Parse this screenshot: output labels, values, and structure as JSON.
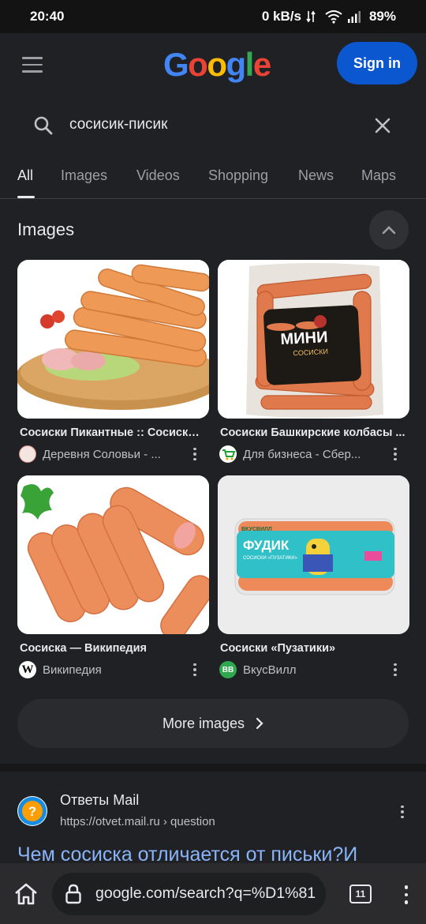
{
  "status_bar": {
    "time": "20:40",
    "network_speed": "0 kB/s",
    "battery": "89%"
  },
  "header": {
    "logo_letters": [
      "G",
      "o",
      "o",
      "g",
      "l",
      "e"
    ],
    "signin_label": "Sign in"
  },
  "search": {
    "query": "сосисик-писик"
  },
  "tabs": [
    {
      "label": "All",
      "active": true
    },
    {
      "label": "Images",
      "active": false
    },
    {
      "label": "Videos",
      "active": false
    },
    {
      "label": "Shopping",
      "active": false
    },
    {
      "label": "News",
      "active": false
    },
    {
      "label": "Maps",
      "active": false
    }
  ],
  "images_section": {
    "title": "Images",
    "results": [
      {
        "title": "Сосиски Пикантные :: Сосиски ...",
        "source": "Деревня Соловьи - ..."
      },
      {
        "title": "Сосиски Башкирские колбасы ...",
        "source": "Для бизнеса - Сбер..."
      },
      {
        "title": "Сосиска — Википедия",
        "source": "Википедия"
      },
      {
        "title": "Сосиски «Пузатики»",
        "source": "ВкусВилл"
      }
    ],
    "package_texts": {
      "mini_brand": "МИНИ",
      "mini_sub": "СОСИСКИ",
      "vkusvill_brand": "ВКУСВИЛЛ",
      "fudik": "ФУДИК",
      "fudik_sub": "СОСИСКИ «ПУЗАТИКИ»"
    },
    "more_label": "More images"
  },
  "result": {
    "site_name": "Ответы Mail",
    "url": "https://otvet.mail.ru › question",
    "title": "Чем сосиска отличается от письки?И"
  },
  "browser": {
    "url": "google.com/search?q=%D1%81",
    "tab_count": "11"
  },
  "colors": {
    "background": "#202124",
    "link": "#8ab4f8",
    "signin": "#0b57d0"
  }
}
